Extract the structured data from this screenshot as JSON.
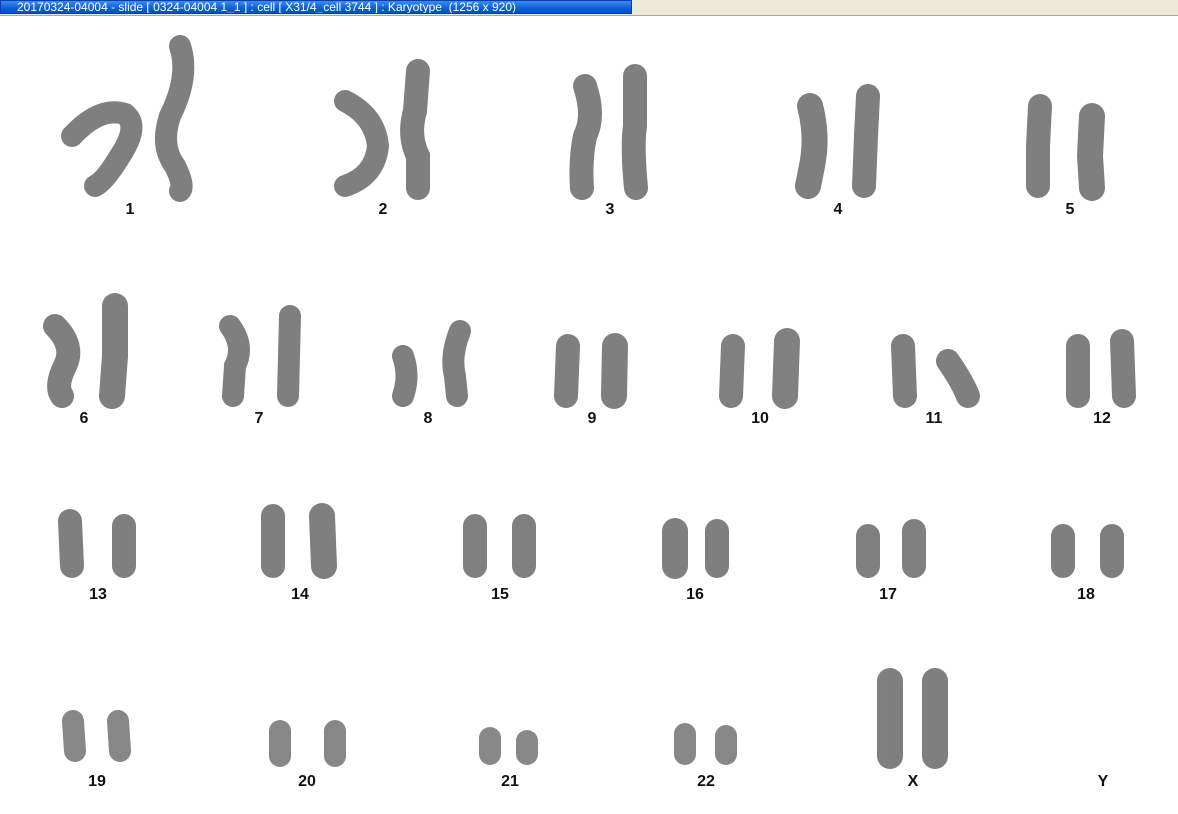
{
  "window": {
    "title": "20170324-04004 - slide [ 0324-04004 1_1 ] : cell [ X31/4_cell 3744 ] : Karyotype  (1256 x 920)"
  },
  "colors": {
    "title_bar": "#0a5fd8",
    "chromosome": "#4a4a4a",
    "background": "#ffffff"
  },
  "karyotype": {
    "labels": [
      "1",
      "2",
      "3",
      "4",
      "5",
      "6",
      "7",
      "8",
      "9",
      "10",
      "11",
      "12",
      "13",
      "14",
      "15",
      "16",
      "17",
      "18",
      "19",
      "20",
      "21",
      "22",
      "X",
      "Y"
    ]
  }
}
